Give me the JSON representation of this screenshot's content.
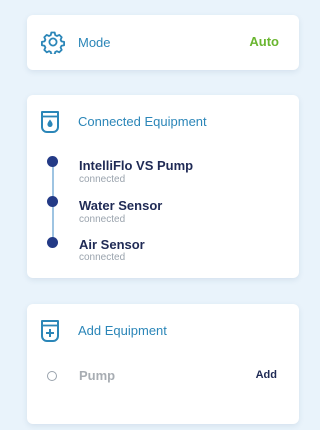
{
  "mode": {
    "label": "Mode",
    "value": "Auto",
    "icon": "gear-icon"
  },
  "connected": {
    "title": "Connected Equipment",
    "icon": "pool-water-drop-icon",
    "items": [
      {
        "name": "IntelliFlo VS Pump",
        "status": "connected"
      },
      {
        "name": "Water Sensor",
        "status": "connected"
      },
      {
        "name": "Air Sensor",
        "status": "connected"
      }
    ]
  },
  "add_equipment": {
    "title": "Add Equipment",
    "icon": "pool-plus-icon",
    "items": [
      {
        "name": "Pump",
        "action": "Add"
      }
    ]
  },
  "colors": {
    "accent_blue": "#2b86b8",
    "mode_green": "#6ab630",
    "dot_navy": "#233a86",
    "background": "#e9f3fb"
  }
}
